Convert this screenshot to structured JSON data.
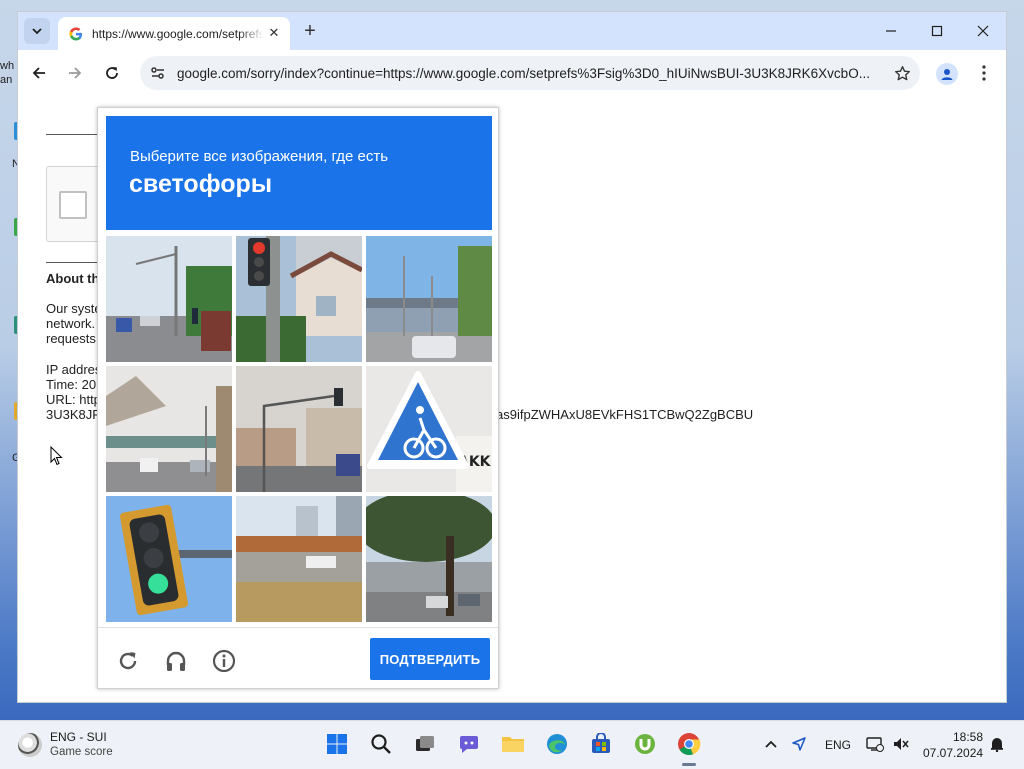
{
  "browser": {
    "tab_title": "https://www.google.com/setprefs",
    "url": "google.com/sorry/index?continue=https://www.google.com/setprefs%3Fsig%3D0_hIUiNwsBUI-3U3K8JRK6XvcbO..."
  },
  "desktop": {
    "frag1": "wh",
    "frag2": "an",
    "frag3": "N",
    "frag4": "G"
  },
  "page": {
    "about_heading": "About th",
    "para_line1": "Our syste",
    "para_line2": "network.",
    "para_line3": "requests",
    "ip_label": "IP addres",
    "time_label": "Time: 20",
    "url_label": "URL: http",
    "url_cont": "3U3K8JF",
    "url_tail": "as9ifpZWHAxU8EVkFHS1TCBwQ2ZgBCBU"
  },
  "captcha": {
    "instruction": "Выберите все изображения, где есть",
    "target": "светофоры",
    "verify_label": "ПОДТВЕРДИТЬ",
    "tiles": [
      "street-intersection",
      "traffic-light-red",
      "overpass-road",
      "overpass-street",
      "traffic-light-pole",
      "bicycle-sign",
      "traffic-light-green",
      "empty-intersection",
      "trees-road"
    ]
  },
  "taskbar": {
    "widget_title": "ENG - SUI",
    "widget_sub": "Game score",
    "lang": "ENG",
    "time": "18:58",
    "date": "07.07.2024"
  },
  "colors": {
    "accent": "#1a73e8",
    "tabbar": "#d3e3fd"
  }
}
